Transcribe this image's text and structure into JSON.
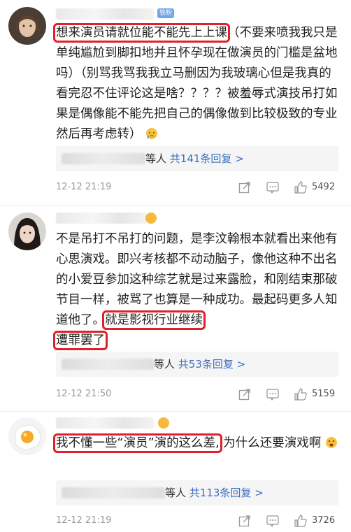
{
  "comments": [
    {
      "badge": "铁粉",
      "highlight": "想来演员请就位能不能先上上课",
      "rest": "（不要来喷我我只是单纯尴尬到脚扣地并且怀孕现在做演员的门槛是盆地吗）（别骂我骂我我立马删因为我玻璃心但是我真的看完忍不住评论这是啥？？？？被羞辱式演技吊打如果是偶像能不能先把自己的偶像做到比较极致的专业然后再考虑转）",
      "reply_suffix": "等人",
      "reply_count": "共141条回复 >",
      "time": "12-12 21:19",
      "likes": "5492"
    },
    {
      "text_before": "不是吊打不吊打的问题，是李汶翰根本就看出来他有心思演戏。即兴考核都不动动脑子，像他这种不出名的小爱豆参加这种综艺就是过来露脸，和刚结束那破节目一样，被骂了也算是一种成功。最起码更多人知道他了。",
      "highlight_1": "就是影视行业继续",
      "highlight_2": "遭罪罢了",
      "reply_suffix": "等人",
      "reply_count": "共53条回复 >",
      "time": "12-12 21:50",
      "likes": "5159"
    },
    {
      "highlight": "我不懂一些“演员”演的这么差,",
      "rest": "为什么还要演戏啊",
      "reply_suffix": "等人",
      "reply_count": "共113条回复 >",
      "time": "12-12 21:19",
      "likes": "3726"
    }
  ],
  "colors": {
    "highlight_border": "#e0202a",
    "reply_link": "#3b6fbf",
    "meta_gray": "#9a9a9a"
  }
}
